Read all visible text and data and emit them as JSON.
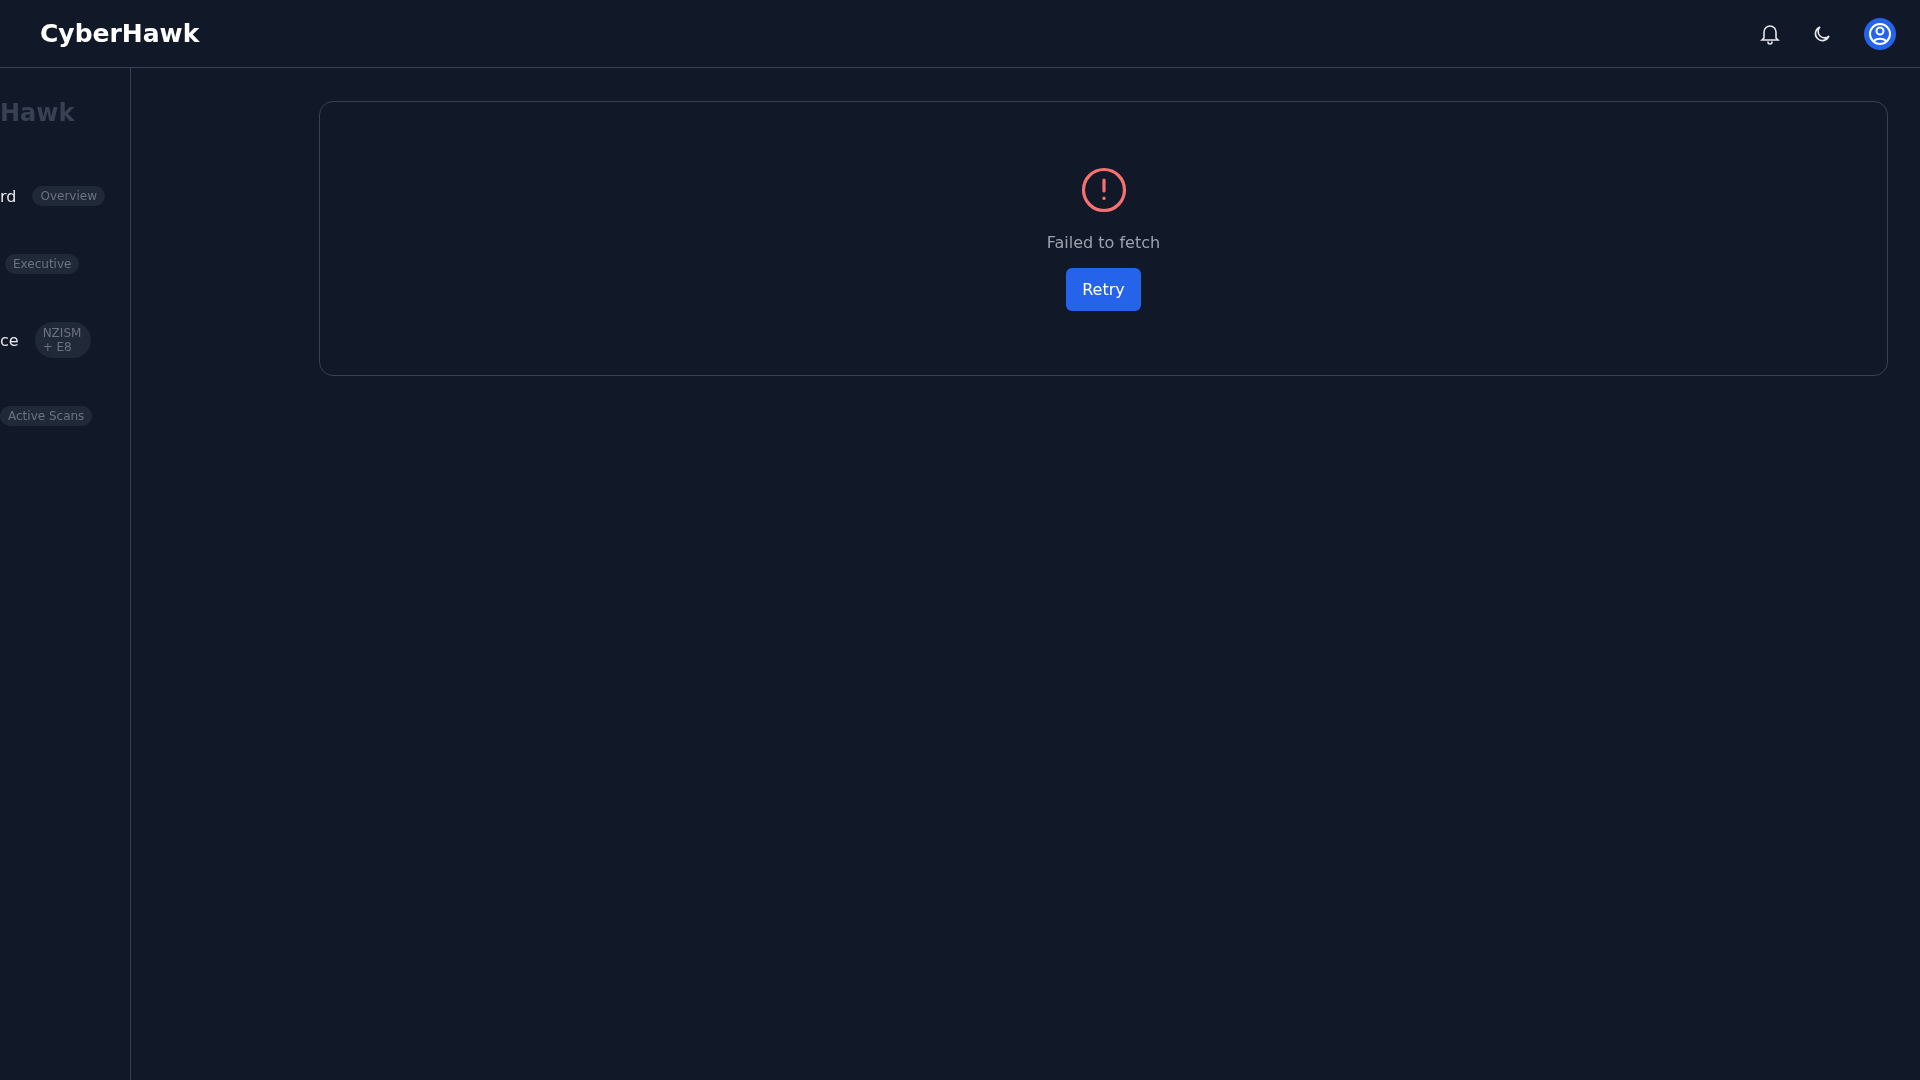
{
  "header": {
    "title": "CyberHawk"
  },
  "sidebar": {
    "brand": "Hawk",
    "items": [
      {
        "label": "rd",
        "badge": "Overview"
      },
      {
        "badge": "Executive"
      },
      {
        "label": "ce",
        "badge": "NZISM + E8"
      },
      {
        "badge": "Active Scans"
      }
    ]
  },
  "error_card": {
    "message": "Failed to fetch",
    "button": "Retry"
  }
}
